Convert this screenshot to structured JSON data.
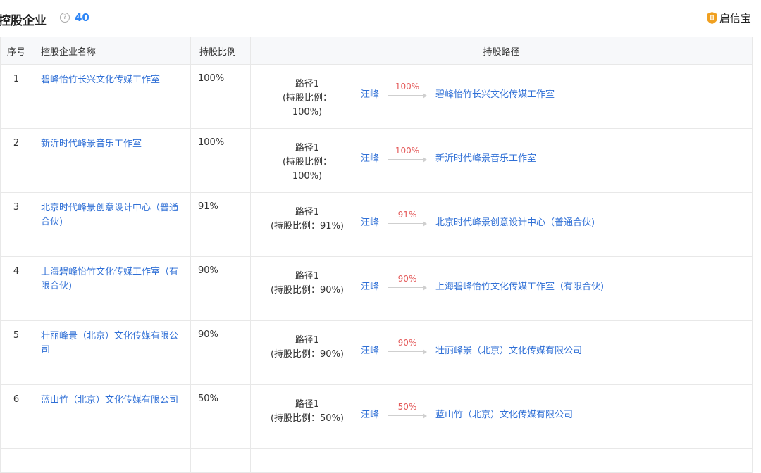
{
  "header": {
    "title": "控股企业",
    "help_icon": "?",
    "count": "40",
    "brand": "启信宝"
  },
  "columns": [
    "序号",
    "控股企业名称",
    "持股比例",
    "持股路径"
  ],
  "rows": [
    {
      "no": "1",
      "name": "碧峰怡竹长兴文化传媒工作室",
      "pct": "100%",
      "path_title": "路径1",
      "path_detail": "(持股比例：100%)",
      "holder": "汪峰",
      "arrow_pct": "100%",
      "company": "碧峰怡竹长兴文化传媒工作室"
    },
    {
      "no": "2",
      "name": "新沂时代峰景音乐工作室",
      "pct": "100%",
      "path_title": "路径1",
      "path_detail": "(持股比例：100%)",
      "holder": "汪峰",
      "arrow_pct": "100%",
      "company": "新沂时代峰景音乐工作室"
    },
    {
      "no": "3",
      "name": "北京时代峰景创意设计中心（普通合伙)",
      "pct": "91%",
      "path_title": "路径1",
      "path_detail": "(持股比例：91%)",
      "holder": "汪峰",
      "arrow_pct": "91%",
      "company": "北京时代峰景创意设计中心（普通合伙)"
    },
    {
      "no": "4",
      "name": "上海碧峰怡竹文化传媒工作室（有限合伙)",
      "pct": "90%",
      "path_title": "路径1",
      "path_detail": "(持股比例：90%)",
      "holder": "汪峰",
      "arrow_pct": "90%",
      "company": "上海碧峰怡竹文化传媒工作室（有限合伙)"
    },
    {
      "no": "5",
      "name": "壮丽峰景（北京）文化传媒有限公司",
      "pct": "90%",
      "path_title": "路径1",
      "path_detail": "(持股比例：90%)",
      "holder": "汪峰",
      "arrow_pct": "90%",
      "company": "壮丽峰景（北京）文化传媒有限公司"
    },
    {
      "no": "6",
      "name": "蓝山竹（北京）文化传媒有限公司",
      "pct": "50%",
      "path_title": "路径1",
      "path_detail": "(持股比例：50%)",
      "holder": "汪峰",
      "arrow_pct": "50%",
      "company": "蓝山竹（北京）文化传媒有限公司"
    }
  ],
  "colors": {
    "link": "#2f6fd6",
    "count": "#2f86f6",
    "arrow_pct": "#e45b5b",
    "brand_logo": "#f0a020"
  }
}
